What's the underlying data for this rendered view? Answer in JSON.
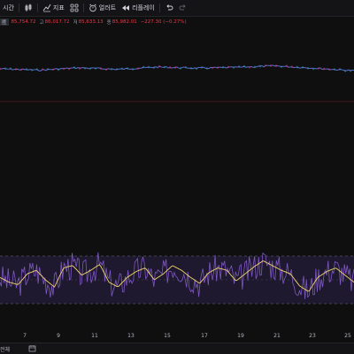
{
  "toolbar": {
    "interval_label": "시간",
    "indicators_label": "지표",
    "alert_label": "얼러트",
    "replay_label": "리플레이",
    "icons": [
      "candles-icon",
      "indicators-icon",
      "templates-grid-icon",
      "alert-icon",
      "replay-icon",
      "undo-icon",
      "redo-icon"
    ]
  },
  "legend": {
    "symbol": "匿",
    "open_value": "85,754.72",
    "high_label": "고",
    "high_value": "86,017.72",
    "low_label": "저",
    "low_value": "85,633.13",
    "close_label": "종",
    "close_value": "85,982.01",
    "change": "−227.30 (−0.27%)"
  },
  "colors": {
    "background": "#0f0f10",
    "up": "#26a69a",
    "down": "#f23645",
    "price_line": "#5b6bd6",
    "rsi_line": "#7e57c2",
    "rsi_ma": "#f5d76e",
    "rsi_band": "#2a1f45"
  },
  "chart_data": [
    {
      "type": "line",
      "name": "price",
      "x": [
        "7",
        "9",
        "11",
        "13",
        "15",
        "17",
        "19",
        "21",
        "23",
        "25"
      ],
      "values": [
        0.45,
        0.52,
        0.4,
        0.48,
        0.36,
        0.42,
        0.38,
        0.3,
        0.42,
        0.55
      ]
    },
    {
      "type": "line",
      "name": "oscillator",
      "bands": [
        70,
        30
      ],
      "values": [
        52,
        48,
        46,
        55,
        58,
        50,
        44,
        60,
        62,
        54,
        58,
        63,
        48,
        44,
        52,
        57,
        60,
        50,
        55,
        62,
        58,
        52,
        47,
        56,
        60,
        58,
        49,
        55,
        61,
        66,
        62,
        58,
        55,
        45,
        40,
        52,
        57,
        60,
        54,
        48
      ]
    }
  ],
  "xaxis_labels": [
    "7",
    "9",
    "11",
    "13",
    "15",
    "17",
    "19",
    "21",
    "23",
    "25"
  ],
  "bottom": {
    "range_label": "전체"
  }
}
